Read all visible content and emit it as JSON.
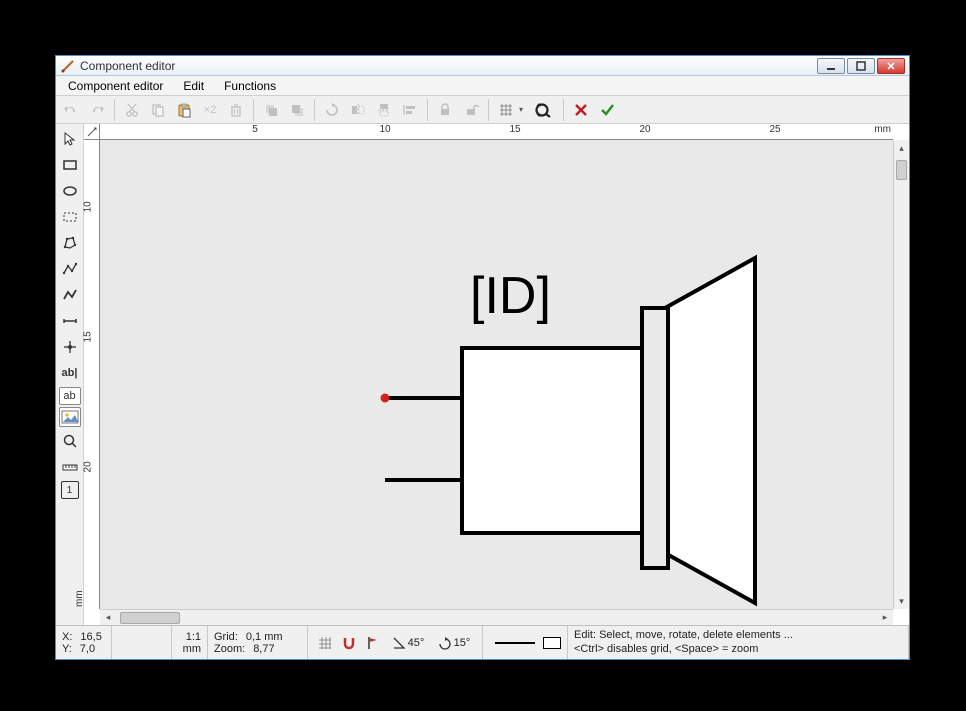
{
  "window": {
    "title": "Component editor"
  },
  "menu": {
    "items": [
      "Component editor",
      "Edit",
      "Functions"
    ]
  },
  "toolbar": {
    "undo": "undo",
    "redo": "redo",
    "cut": "cut",
    "copy": "copy",
    "paste": "paste",
    "duplicate_label": "×2",
    "delete": "delete",
    "group": "group",
    "ungroup": "ungroup",
    "rotate": "rotate",
    "mirror_h": "mirror-h",
    "mirror_v": "mirror-v",
    "align": "align",
    "lock": "lock",
    "unlock": "unlock",
    "grid": "grid",
    "zoom": "zoom",
    "cancel": "cancel",
    "ok": "ok"
  },
  "tools": {
    "select": "select",
    "rect": "rectangle",
    "ellipse": "ellipse",
    "zone": "zone",
    "polygon": "polygon",
    "polyline": "polyline",
    "special": "special-line",
    "connection": "connection",
    "pin": "pin",
    "text": "ab|",
    "text2": "ab",
    "image": "image",
    "zoom": "zoom",
    "measure": "measure",
    "frame": "1"
  },
  "ruler": {
    "unit": "mm",
    "h_ticks": [
      5,
      10,
      15,
      20,
      25
    ],
    "v_ticks": [
      10,
      15,
      20
    ]
  },
  "drawing": {
    "label_text": "[ID]"
  },
  "status": {
    "x_label": "X:",
    "x_val": "16,5",
    "y_label": "Y:",
    "y_val": "7,0",
    "scale_label": "1:1",
    "scale_unit": "mm",
    "grid_label": "Grid:",
    "grid_val": "0,1 mm",
    "zoom_label": "Zoom:",
    "zoom_val": "8,77",
    "angle1": "45°",
    "angle2": "15°",
    "hint1": "Edit: Select, move, rotate, delete elements ...",
    "hint2": "<Ctrl> disables grid, <Space> = zoom"
  }
}
